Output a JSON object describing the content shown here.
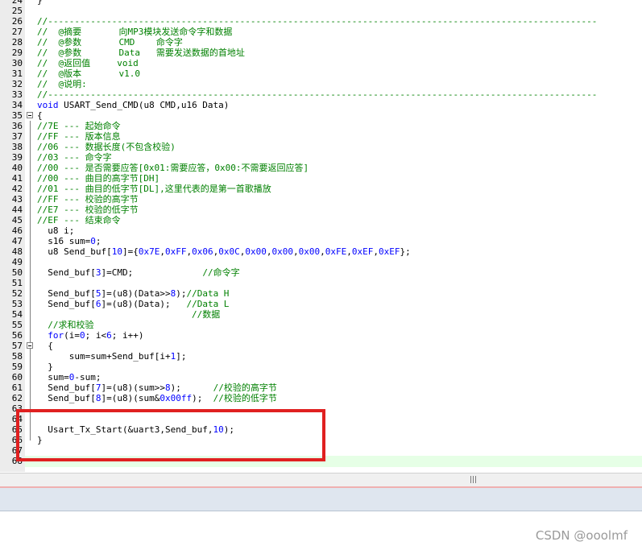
{
  "editor": {
    "lines": [
      {
        "num": "24",
        "text": "}",
        "type": "code"
      },
      {
        "num": "25",
        "text": "",
        "type": "code"
      },
      {
        "num": "26",
        "text": "//-------------------------------------------------------------------------------------------------------",
        "type": "comment"
      },
      {
        "num": "27",
        "text": "//  @摘要       向MP3模块发送命令字和数据",
        "type": "comment"
      },
      {
        "num": "28",
        "text": "//  @参数       CMD    命令字",
        "type": "comment"
      },
      {
        "num": "29",
        "text": "//  @参数       Data   需要发送数据的首地址",
        "type": "comment"
      },
      {
        "num": "30",
        "text": "//  @返回值     void",
        "type": "comment"
      },
      {
        "num": "31",
        "text": "//  @版本       v1.0",
        "type": "comment"
      },
      {
        "num": "32",
        "text": "//  @说明:",
        "type": "comment"
      },
      {
        "num": "33",
        "text": "//-------------------------------------------------------------------------------------------------------",
        "type": "comment"
      },
      {
        "num": "34",
        "text": "void USART_Send_CMD(u8 CMD,u16 Data)",
        "type": "void-decl"
      },
      {
        "num": "35",
        "text": "{",
        "type": "code"
      },
      {
        "num": "36",
        "text": "//7E --- 起始命令",
        "type": "comment"
      },
      {
        "num": "37",
        "text": "//FF --- 版本信息",
        "type": "comment"
      },
      {
        "num": "38",
        "text": "//06 --- 数据长度(不包含校验)",
        "type": "comment"
      },
      {
        "num": "39",
        "text": "//03 --- 命令字",
        "type": "comment"
      },
      {
        "num": "40",
        "text": "//00 --- 是否需要应答[0x01:需要应答，0x00:不需要返回应答]",
        "type": "comment"
      },
      {
        "num": "41",
        "text": "//00 --- 曲目的高字节[DH]",
        "type": "comment"
      },
      {
        "num": "42",
        "text": "//01 --- 曲目的低字节[DL],这里代表的是第一首歌播放",
        "type": "comment"
      },
      {
        "num": "43",
        "text": "//FF --- 校验的高字节",
        "type": "comment"
      },
      {
        "num": "44",
        "text": "//E7 --- 校验的低字节",
        "type": "comment"
      },
      {
        "num": "45",
        "text": "//EF --- 结束命令",
        "type": "comment"
      },
      {
        "num": "46",
        "text": "  u8 i;",
        "type": "code"
      },
      {
        "num": "47",
        "text": "  s16 sum=0;",
        "type": "code"
      },
      {
        "num": "48",
        "text": "  u8 Send_buf[10]={0x7E,0xFF,0x06,0x0C,0x00,0x00,0x00,0xFE,0xEF,0xEF};",
        "type": "code"
      },
      {
        "num": "49",
        "text": "",
        "type": "code"
      },
      {
        "num": "50",
        "text": "  Send_buf[3]=CMD;             //命令字",
        "type": "code"
      },
      {
        "num": "51",
        "text": "",
        "type": "code"
      },
      {
        "num": "52",
        "text": "  Send_buf[5]=(u8)(Data>>8);//Data H",
        "type": "code"
      },
      {
        "num": "53",
        "text": "  Send_buf[6]=(u8)(Data);   //Data L",
        "type": "code"
      },
      {
        "num": "54",
        "text": "                             //数据",
        "type": "comment"
      },
      {
        "num": "55",
        "text": "  //求和校验",
        "type": "comment"
      },
      {
        "num": "56",
        "text": "  for(i=0; i<6; i++)",
        "type": "for"
      },
      {
        "num": "57",
        "text": "  {",
        "type": "code"
      },
      {
        "num": "58",
        "text": "      sum=sum+Send_buf[i+1];",
        "type": "code"
      },
      {
        "num": "59",
        "text": "  }",
        "type": "code"
      },
      {
        "num": "60",
        "text": "  sum=0-sum;",
        "type": "code"
      },
      {
        "num": "61",
        "text": "  Send_buf[7]=(u8)(sum>>8);      //校验的高字节",
        "type": "code"
      },
      {
        "num": "62",
        "text": "  Send_buf[8]=(u8)(sum&0x00ff);  //校验的低字节",
        "type": "code"
      },
      {
        "num": "63",
        "text": "",
        "type": "code"
      },
      {
        "num": "64",
        "text": "",
        "type": "code"
      },
      {
        "num": "65",
        "text": "  Usart_Tx_Start(&uart3,Send_buf,10);",
        "type": "code"
      },
      {
        "num": "66",
        "text": "}",
        "type": "code"
      },
      {
        "num": "67",
        "text": "",
        "type": "code"
      },
      {
        "num": "68",
        "text": "",
        "type": "code"
      }
    ],
    "fold_markers": [
      "35",
      "57"
    ]
  },
  "scrollbar": {
    "grip": "|||"
  },
  "watermark": "CSDN @ooolmf",
  "colors": {
    "comment": "#008000",
    "keyword": "#0000ff",
    "highlight_box": "#e02020",
    "current_line": "#e6ffe6"
  }
}
